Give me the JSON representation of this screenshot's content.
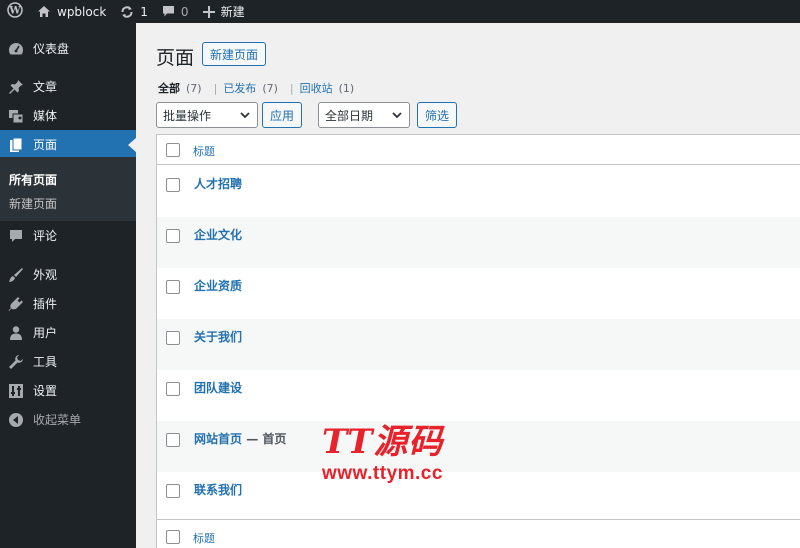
{
  "adminbar": {
    "site_name": "wpblock",
    "updates_count": "1",
    "comments_count": "0",
    "new_label": "新建"
  },
  "sidebar": {
    "items": [
      {
        "label": "仪表盘",
        "icon": "dashboard-icon"
      },
      {
        "label": "文章",
        "icon": "pin-icon"
      },
      {
        "label": "媒体",
        "icon": "media-icon"
      },
      {
        "label": "页面",
        "icon": "page-icon"
      },
      {
        "label": "评论",
        "icon": "comment-icon"
      },
      {
        "label": "外观",
        "icon": "brush-icon"
      },
      {
        "label": "插件",
        "icon": "plugin-icon"
      },
      {
        "label": "用户",
        "icon": "user-icon"
      },
      {
        "label": "工具",
        "icon": "wrench-icon"
      },
      {
        "label": "设置",
        "icon": "settings-icon"
      },
      {
        "label": "收起菜单",
        "icon": "collapse-icon"
      }
    ],
    "submenu": [
      "所有页面",
      "新建页面"
    ]
  },
  "main": {
    "title": "页面",
    "add_new": "新建页面",
    "filters": {
      "all": "全部",
      "all_count": "(7)",
      "published": "已发布",
      "published_count": "(7)",
      "trash": "回收站",
      "trash_count": "(1)"
    },
    "bulk_actions": "批量操作",
    "apply": "应用",
    "all_dates": "全部日期",
    "filter": "筛选",
    "column_title": "标题",
    "rows": [
      {
        "title": "人才招聘",
        "state": ""
      },
      {
        "title": "企业文化",
        "state": ""
      },
      {
        "title": "企业资质",
        "state": ""
      },
      {
        "title": "关于我们",
        "state": ""
      },
      {
        "title": "团队建设",
        "state": ""
      },
      {
        "title": "网站首页",
        "state": "— 首页"
      },
      {
        "title": "联系我们",
        "state": ""
      }
    ]
  },
  "watermark": {
    "logo": "TT源码",
    "url": "www.ttym.cc"
  },
  "colors": {
    "adminbar_bg": "#1d2327",
    "accent": "#2271b1",
    "watermark": "#e8212a"
  }
}
